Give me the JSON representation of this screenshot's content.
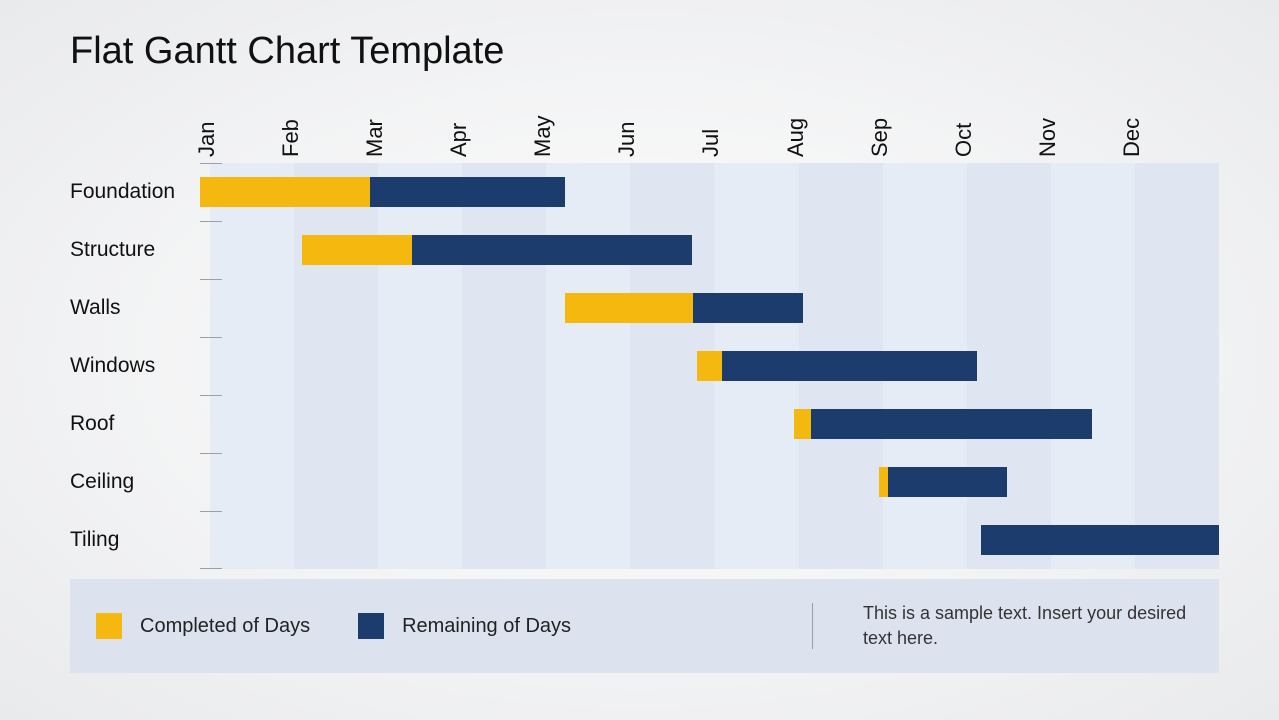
{
  "title": "Flat Gantt Chart Template",
  "legend": {
    "completed": "Completed of Days",
    "remaining": "Remaining of Days"
  },
  "note": "This is a sample text. Insert your desired text here.",
  "chart_data": {
    "type": "bar",
    "title": "Flat Gantt Chart Template",
    "xlabel": "",
    "ylabel": "",
    "categories": [
      "Jan",
      "Feb",
      "Mar",
      "Apr",
      "May",
      "Jun",
      "Jul",
      "Aug",
      "Sep",
      "Oct",
      "Nov",
      "Dec"
    ],
    "tasks": [
      {
        "name": "Foundation",
        "start": 0,
        "completed": 2.0,
        "remaining": 2.3
      },
      {
        "name": "Structure",
        "start": 1.2,
        "completed": 1.3,
        "remaining": 3.3
      },
      {
        "name": "Walls",
        "start": 4.3,
        "completed": 1.5,
        "remaining": 1.3
      },
      {
        "name": "Windows",
        "start": 5.85,
        "completed": 0.3,
        "remaining": 3.0
      },
      {
        "name": "Roof",
        "start": 7.0,
        "completed": 0.2,
        "remaining": 3.3
      },
      {
        "name": "Ceiling",
        "start": 8.0,
        "completed": 0.1,
        "remaining": 1.4
      },
      {
        "name": "Tiling",
        "start": 9.2,
        "completed": 0.0,
        "remaining": 2.8
      }
    ],
    "series": [
      {
        "name": "Completed of Days",
        "color": "#f5b80f"
      },
      {
        "name": "Remaining of Days",
        "color": "#1d3c6e"
      }
    ]
  }
}
